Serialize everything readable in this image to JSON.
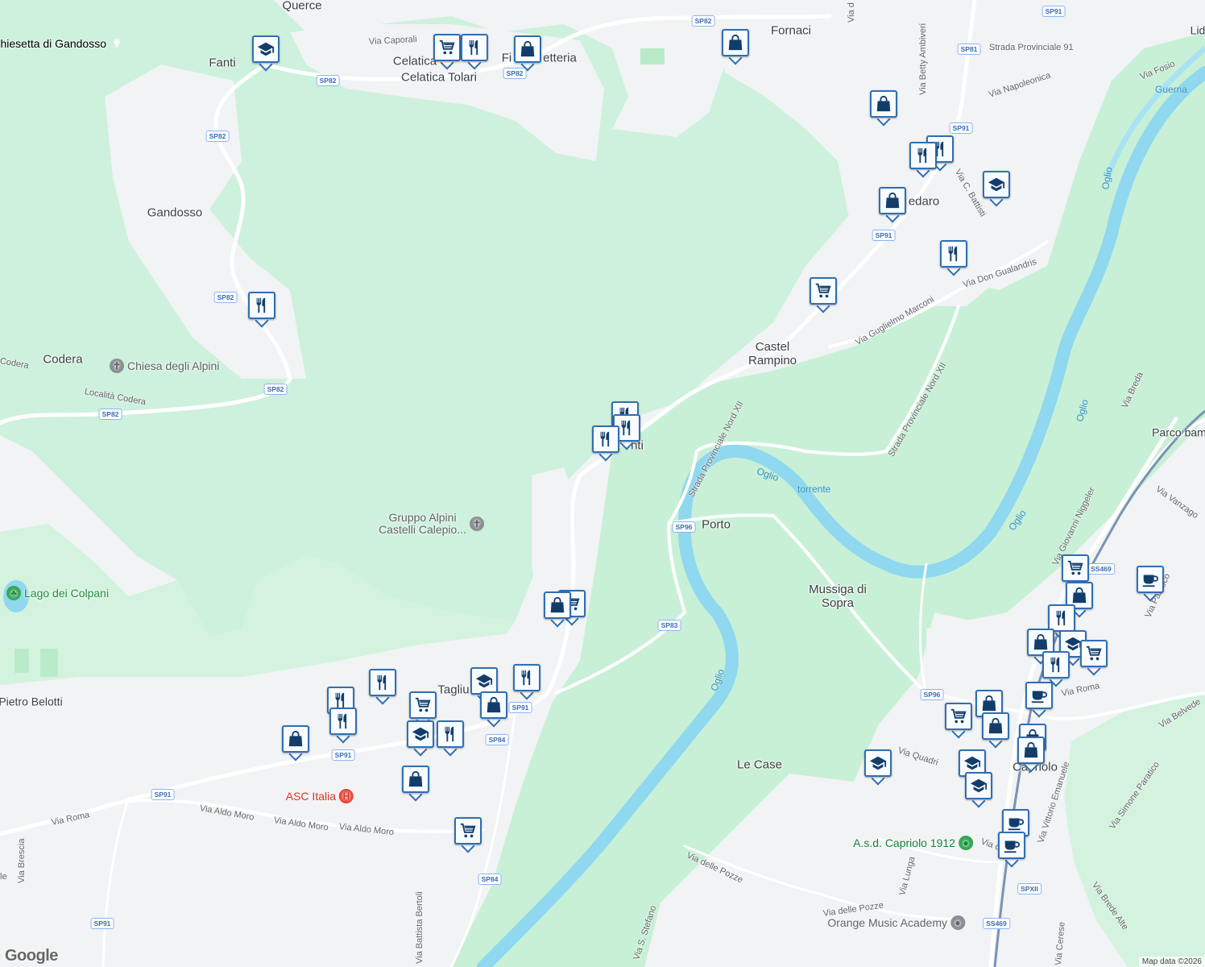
{
  "map": {
    "colors": {
      "land": "#f1f3f4",
      "forest": "#cdf1dc",
      "water": "#8fd8ef",
      "road": "#ffffff",
      "pin": "#2f6fb3"
    },
    "places": [
      {
        "id": "querce",
        "label": "Querce"
      },
      {
        "id": "fanti",
        "label": "Fanti"
      },
      {
        "id": "celatica",
        "label": "Celatica"
      },
      {
        "id": "celatica-tolari",
        "label": "Celatica Tolari"
      },
      {
        "id": "fornaci",
        "label": "Fornaci"
      },
      {
        "id": "gandosso",
        "label": "Gandosso"
      },
      {
        "id": "codera",
        "label": "Codera"
      },
      {
        "id": "castel-rampino",
        "label": "Castel Rampino"
      },
      {
        "id": "porto",
        "label": "Porto"
      },
      {
        "id": "mussiga",
        "label": "Mussiga di Sopra"
      },
      {
        "id": "le-case",
        "label": "Le Case"
      },
      {
        "id": "capriolo",
        "label": "Capriolo"
      },
      {
        "id": "pietro-belotti",
        "label": "Pietro Belotti"
      },
      {
        "id": "parco",
        "label": "Parco bam"
      },
      {
        "id": "lid",
        "label": "Lid"
      },
      {
        "id": "fi",
        "label": "Fi"
      },
      {
        "id": "etteria",
        "label": "etteria"
      },
      {
        "id": "edaro",
        "label": "edaro"
      },
      {
        "id": "nti",
        "label": "nti"
      },
      {
        "id": "tagliu",
        "label": "Tagliu"
      }
    ],
    "roads": [
      {
        "id": "via-caporali",
        "label": "Via Caporali"
      },
      {
        "id": "via-betty",
        "label": "Via Betty Ambiveri"
      },
      {
        "id": "sp91-top",
        "label": "Strada Provinciale 91"
      },
      {
        "id": "via-napoleonica",
        "label": "Via Napoleonica"
      },
      {
        "id": "via-fosio",
        "label": "Via Fosio"
      },
      {
        "id": "via-battisti",
        "label": "Via C. Battisti"
      },
      {
        "id": "via-gualandris",
        "label": "Via Don Gualandris"
      },
      {
        "id": "via-marconi",
        "label": "Via Guglielmo Marconi"
      },
      {
        "id": "spn12-a",
        "label": "Strada Provinciale Nord XII"
      },
      {
        "id": "spn12-b",
        "label": "Strada Provinciale Nord XII"
      },
      {
        "id": "codera-road",
        "label": "Codera"
      },
      {
        "id": "localita-codera",
        "label": "Località Codera"
      },
      {
        "id": "via-breda",
        "label": "Via Breda"
      },
      {
        "id": "via-vanzago",
        "label": "Via Vanzago"
      },
      {
        "id": "via-niggeler",
        "label": "Via Giovanni Niggeler"
      },
      {
        "id": "via-paratico",
        "label": "Via Paratico"
      },
      {
        "id": "via-roma-right",
        "label": "Via Roma"
      },
      {
        "id": "via-belvedere",
        "label": "Via Belvede"
      },
      {
        "id": "via-quadri",
        "label": "Via Quadri"
      },
      {
        "id": "via-ve",
        "label": "Via Vittorio Emanuele"
      },
      {
        "id": "via-simone",
        "label": "Via Simone Paratico"
      },
      {
        "id": "via-lunga",
        "label": "Via Lunga"
      },
      {
        "id": "via-pozze-1",
        "label": "Via delle Pozze"
      },
      {
        "id": "via-pozze-2",
        "label": "Via delle Pozze"
      },
      {
        "id": "via-stefano",
        "label": "Via S. Stefano"
      },
      {
        "id": "via-cerese",
        "label": "Via Cerese"
      },
      {
        "id": "via-brede",
        "label": "Via Brede Alte"
      },
      {
        "id": "via-roma-left",
        "label": "Via Roma"
      },
      {
        "id": "via-aldo-1",
        "label": "Via Aldo Moro"
      },
      {
        "id": "via-aldo-2",
        "label": "Via Aldo Moro"
      },
      {
        "id": "via-aldo-3",
        "label": "Via Aldo Moro"
      },
      {
        "id": "via-brescia",
        "label": "Via Brescia"
      },
      {
        "id": "via-bertoli",
        "label": "Via Battista Bertoli"
      },
      {
        "id": "via-trunc-1",
        "label": "Via d"
      },
      {
        "id": "via-trunc-2",
        "label": "Via d"
      },
      {
        "id": "chiesetta-road",
        "label": "le"
      }
    ],
    "water_labels": [
      {
        "id": "guerna",
        "label": "Guerna"
      },
      {
        "id": "oglio-1",
        "label": "Oglio"
      },
      {
        "id": "oglio-2",
        "label": "Oglio"
      },
      {
        "id": "oglio-3",
        "label": "Oglio"
      },
      {
        "id": "oglio-4",
        "label": "Oglio"
      },
      {
        "id": "oglio-torrente",
        "label": "torrente"
      },
      {
        "id": "oglio-5",
        "label": "Oglio"
      }
    ],
    "shields": [
      {
        "id": "s1",
        "label": "SP82"
      },
      {
        "id": "s2",
        "label": "SP82"
      },
      {
        "id": "s3",
        "label": "SP82"
      },
      {
        "id": "s4",
        "label": "SP82"
      },
      {
        "id": "s5",
        "label": "SP82"
      },
      {
        "id": "s6",
        "label": "SP82"
      },
      {
        "id": "s7",
        "label": "SP82"
      },
      {
        "id": "s8",
        "label": "SP91"
      },
      {
        "id": "s9",
        "label": "SP81"
      },
      {
        "id": "s10",
        "label": "SP91"
      },
      {
        "id": "s11",
        "label": "SP91"
      },
      {
        "id": "s12",
        "label": "SP96"
      },
      {
        "id": "s13",
        "label": "SP83"
      },
      {
        "id": "s14",
        "label": "SS469"
      },
      {
        "id": "s15",
        "label": "SP96"
      },
      {
        "id": "s16",
        "label": "SP91"
      },
      {
        "id": "s17",
        "label": "SP84"
      },
      {
        "id": "s18",
        "label": "SP91"
      },
      {
        "id": "s19",
        "label": "SP91"
      },
      {
        "id": "s20",
        "label": "SP91"
      },
      {
        "id": "s21",
        "label": "SP84"
      },
      {
        "id": "s22",
        "label": "SPXII"
      },
      {
        "id": "s23",
        "label": "SS469"
      }
    ],
    "pois": [
      {
        "id": "chiesetta",
        "label": "hiesetta di Gandosso",
        "icon": "church-icon"
      },
      {
        "id": "chiesa-alpini",
        "label": "Chiesa degli Alpini",
        "icon": "church-icon"
      },
      {
        "id": "gruppo-alpini",
        "label": "Gruppo Alpini\nCastelli Calepio...",
        "icon": "church-icon"
      },
      {
        "id": "lago-colpani",
        "label": "Lago dei Colpani",
        "icon": "tree-icon"
      },
      {
        "id": "asc-italia",
        "label": "ASC Italia",
        "icon": "hospital-icon"
      },
      {
        "id": "asd-capriolo",
        "label": "A.s.d. Capriolo 1912",
        "icon": "soccer-icon"
      },
      {
        "id": "orange-music",
        "label": "Orange Music Academy",
        "icon": "music-icon"
      }
    ],
    "markers": [
      {
        "id": "m1",
        "type": "school"
      },
      {
        "id": "m2",
        "type": "shop"
      },
      {
        "id": "m3",
        "type": "food"
      },
      {
        "id": "m4",
        "type": "bag"
      },
      {
        "id": "m5",
        "type": "bag"
      },
      {
        "id": "m6",
        "type": "bag"
      },
      {
        "id": "m7",
        "type": "food"
      },
      {
        "id": "m8",
        "type": "food"
      },
      {
        "id": "m9",
        "type": "school"
      },
      {
        "id": "m10",
        "type": "bag"
      },
      {
        "id": "m11",
        "type": "food"
      },
      {
        "id": "m12",
        "type": "shop"
      },
      {
        "id": "m13",
        "type": "food"
      },
      {
        "id": "m14",
        "type": "food"
      },
      {
        "id": "m15",
        "type": "food"
      },
      {
        "id": "m16",
        "type": "food"
      },
      {
        "id": "m17",
        "type": "shop"
      },
      {
        "id": "m18",
        "type": "bag"
      },
      {
        "id": "m19",
        "type": "food"
      },
      {
        "id": "m20",
        "type": "school"
      },
      {
        "id": "m21",
        "type": "food"
      },
      {
        "id": "m22",
        "type": "bag"
      },
      {
        "id": "m23",
        "type": "shop"
      },
      {
        "id": "m24",
        "type": "food"
      },
      {
        "id": "m25",
        "type": "food"
      },
      {
        "id": "m26",
        "type": "bag"
      },
      {
        "id": "m27",
        "type": "school"
      },
      {
        "id": "m28",
        "type": "food"
      },
      {
        "id": "m29",
        "type": "bag"
      },
      {
        "id": "m30",
        "type": "shop"
      },
      {
        "id": "m31",
        "type": "coffee"
      },
      {
        "id": "m32",
        "type": "shop"
      },
      {
        "id": "m33",
        "type": "bag"
      },
      {
        "id": "m34",
        "type": "food"
      },
      {
        "id": "m35",
        "type": "bag"
      },
      {
        "id": "m36",
        "type": "school"
      },
      {
        "id": "m37",
        "type": "shop"
      },
      {
        "id": "m38",
        "type": "food"
      },
      {
        "id": "m39",
        "type": "bag"
      },
      {
        "id": "m40",
        "type": "coffee"
      },
      {
        "id": "m41",
        "type": "shop"
      },
      {
        "id": "m42",
        "type": "bag"
      },
      {
        "id": "m43",
        "type": "bag"
      },
      {
        "id": "m44",
        "type": "bag"
      },
      {
        "id": "m45",
        "type": "school"
      },
      {
        "id": "m46",
        "type": "school"
      },
      {
        "id": "m47",
        "type": "school"
      },
      {
        "id": "m48",
        "type": "coffee"
      },
      {
        "id": "m49",
        "type": "coffee"
      }
    ]
  },
  "branding": {
    "logo": "Google",
    "attribution": "Map data ©2026"
  }
}
